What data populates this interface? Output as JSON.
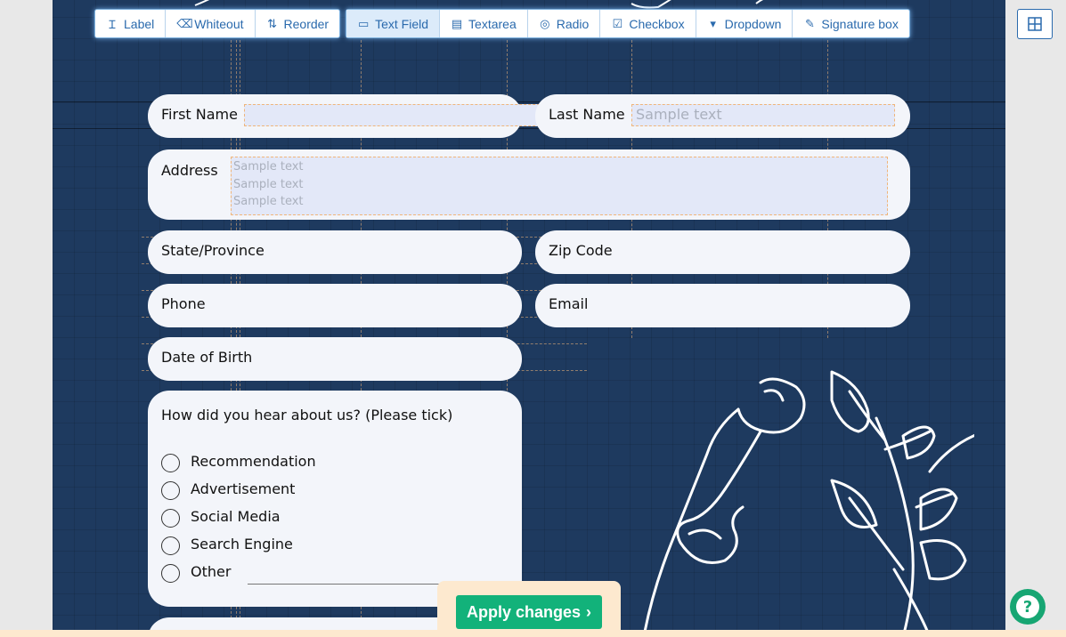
{
  "toolbar": {
    "group1": [
      {
        "label": "Label",
        "icon": "text-size-icon"
      },
      {
        "label": "Whiteout",
        "icon": "eraser-icon"
      },
      {
        "label": "Reorder",
        "icon": "reorder-icon"
      }
    ],
    "group2": [
      {
        "label": "Text Field",
        "icon": "text-field-icon",
        "active": true
      },
      {
        "label": "Textarea",
        "icon": "textarea-icon"
      },
      {
        "label": "Radio",
        "icon": "radio-icon"
      },
      {
        "label": "Checkbox",
        "icon": "checkbox-icon"
      },
      {
        "label": "Dropdown",
        "icon": "dropdown-icon"
      },
      {
        "label": "Signature box",
        "icon": "signature-icon"
      }
    ]
  },
  "form": {
    "first_name": "First Name",
    "last_name": "Last Name",
    "last_name_placeholder": "Sample text",
    "address": "Address",
    "address_placeholder": [
      "Sample text",
      "Sample text",
      "Sample text"
    ],
    "state": "State/Province",
    "zip": "Zip Code",
    "phone": "Phone",
    "email": "Email",
    "dob": "Date of Birth",
    "hear_question": "How did you hear about us? (Please tick)",
    "hear_options": [
      "Recommendation",
      "Advertisement",
      "Social Media",
      "Search Engine",
      "Other"
    ]
  },
  "apply_label": "Apply changes",
  "colors": {
    "page_bg": "#1e3a5f",
    "accent": "#2a6aad",
    "apply": "#12b27a"
  }
}
